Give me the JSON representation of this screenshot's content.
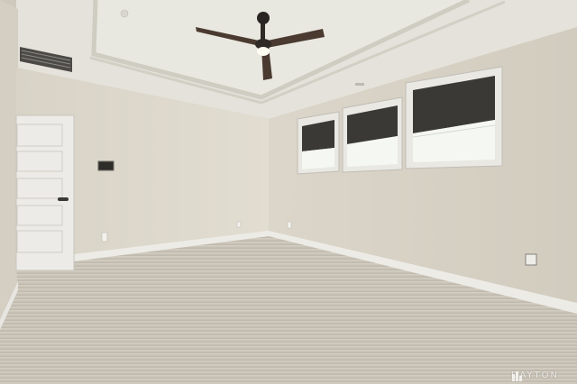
{
  "watermark": {
    "text": "DAYTON"
  },
  "colors": {
    "ceiling": "#e6e4dc",
    "tray_ceiling": "#dcdbd2",
    "wall_left": "#dcd7cb",
    "wall_right": "#d8d2c6",
    "door": "#eceae6",
    "carpet": "#c9c3b7",
    "baseboard": "#ecebe7",
    "fan_blade": "#4a3a30",
    "window_shade": "#3b3a36",
    "window_glass": "#f4f6f2"
  },
  "icons": [
    "ceiling-fan-icon",
    "hvac-vent-icon",
    "thermostat-icon",
    "outlet-icon",
    "watermark-logo-icon"
  ]
}
